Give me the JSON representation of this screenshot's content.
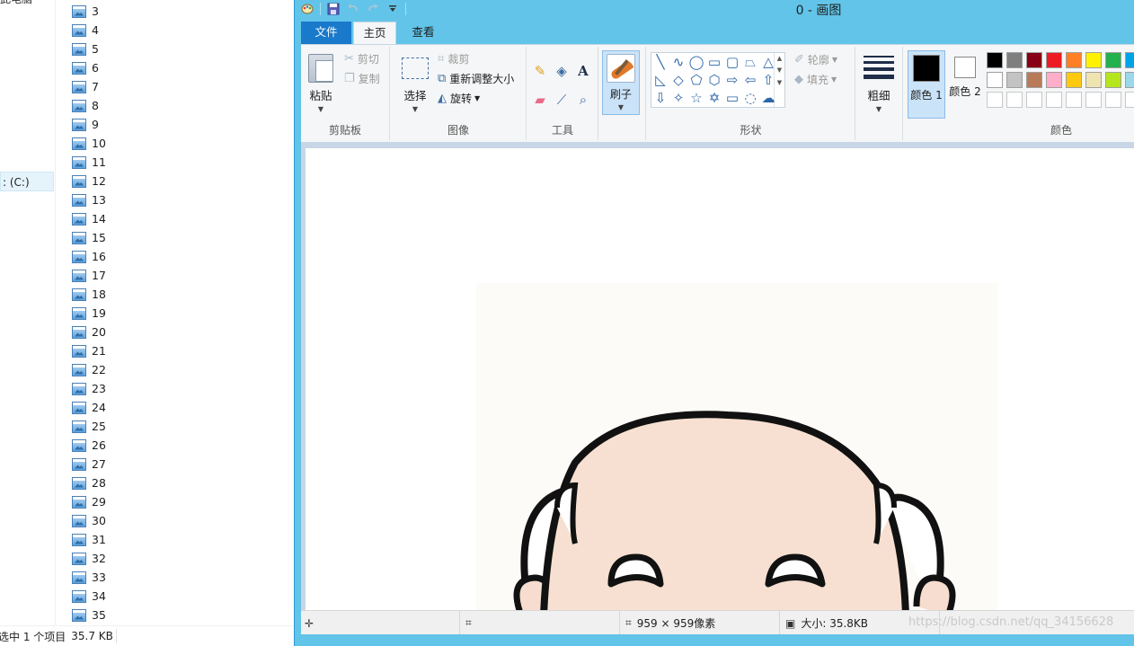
{
  "explorer": {
    "nav_top_label": "此电脑",
    "drive_label": "(C:)",
    "files": [
      "3",
      "4",
      "5",
      "6",
      "7",
      "8",
      "9",
      "10",
      "11",
      "12",
      "13",
      "14",
      "15",
      "16",
      "17",
      "18",
      "19",
      "20",
      "21",
      "22",
      "23",
      "24",
      "25",
      "26",
      "27",
      "28",
      "29",
      "30",
      "31",
      "32",
      "33",
      "34",
      "35"
    ],
    "status": {
      "selected": "选中 1 个项目",
      "size": "35.7 KB"
    }
  },
  "paint": {
    "window_title": "0 - 画图",
    "qat": [
      "paint-app-icon",
      "save-icon",
      "undo-icon",
      "redo-icon",
      "customize-qat-icon"
    ],
    "tabs": {
      "file": "文件",
      "home": "主页",
      "view": "查看"
    },
    "clipboard": {
      "paste": "粘贴",
      "cut": "剪切",
      "copy": "复制",
      "label": "剪贴板"
    },
    "image": {
      "select": "选择",
      "crop": "裁剪",
      "resize": "重新调整大小",
      "rotate": "旋转",
      "label": "图像"
    },
    "tools": {
      "label": "工具",
      "icons": [
        "pencil-icon",
        "fill-bucket-icon",
        "text-icon",
        "eraser-icon",
        "color-picker-icon",
        "magnifier-icon"
      ]
    },
    "brush": {
      "label": "刷子"
    },
    "shapes": {
      "outline": "轮廓",
      "fill": "填充",
      "label": "形状"
    },
    "size": {
      "label": "粗细"
    },
    "colors": {
      "color1": "颜色 1",
      "color2": "颜色 2",
      "label": "颜色",
      "color1_value": "#000000",
      "color2_value": "#ffffff",
      "palette_row1": [
        "#000000",
        "#7f7f7f",
        "#880015",
        "#ed1c24",
        "#ff7f27",
        "#fff200",
        "#22b14c",
        "#00a2e8"
      ],
      "palette_row2": [
        "#ffffff",
        "#c3c3c3",
        "#b97a57",
        "#ffaec9",
        "#ffc90e",
        "#efe4b0",
        "#b5e61d",
        "#99d9ea"
      ]
    },
    "status": {
      "dimensions": "959 × 959像素",
      "file_size": "大小: 35.8KB",
      "watermark": "https://blog.csdn.net/qq_34156628"
    }
  }
}
